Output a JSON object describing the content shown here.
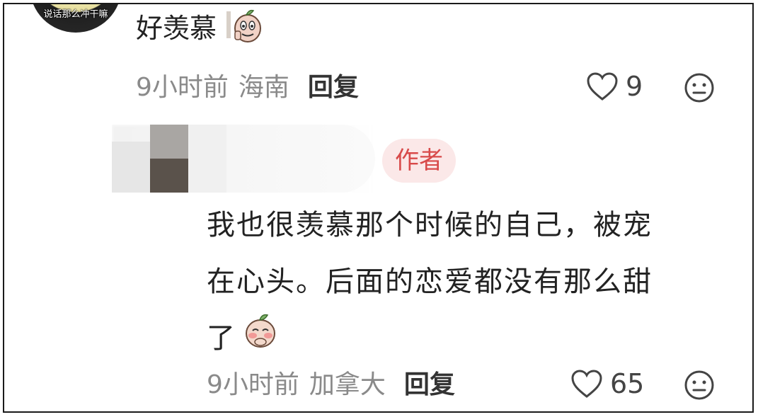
{
  "top_comment": {
    "avatar_text": "说话那么冲干嘛",
    "text": "好羡慕",
    "sticker": "peach-sticker",
    "time": "9小时前",
    "location": "海南",
    "reply_label": "回复",
    "likes": "9",
    "icons": [
      "heart-icon",
      "neutral-face-icon"
    ]
  },
  "author_reply": {
    "badge": "作者",
    "line1": "我也很羡慕那个时候的自己，被宠",
    "line2": "在心头。后面的恋爱都没有那么甜",
    "line3": "了",
    "sticker": "blushing-peach-sticker",
    "time": "9小时前",
    "location": "加拿大",
    "reply_label": "回复",
    "likes": "65",
    "icons": [
      "heart-icon",
      "neutral-face-icon"
    ]
  },
  "colors": {
    "badge_bg": "#fbe8e8",
    "badge_text": "#d84a4a",
    "meta_text": "#8a8a8a",
    "body_text": "#222222"
  }
}
